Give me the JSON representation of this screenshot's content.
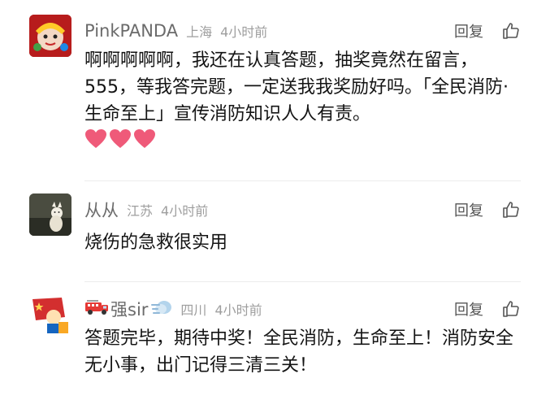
{
  "comments": [
    {
      "username": "PinkPANDA",
      "location": "上海",
      "time": "4小时前",
      "reply": "回复",
      "text": "啊啊啊啊啊，我还在认真答题，抽奖竟然在留言，555，等我答完题，一定送我我奖励好吗。「全民消防·生命至上」宣传消防知识人人有责。",
      "heart_count": 3
    },
    {
      "username": "从从",
      "location": "江苏",
      "time": "4小时前",
      "reply": "回复",
      "text": "烧伤的急救很实用"
    },
    {
      "username": "强sir",
      "location": "四川",
      "time": "4小时前",
      "reply": "回复",
      "text": "答题完毕，期待中奖！全民消防，生命至上！消防安全无小事，出门记得三清三关！"
    }
  ],
  "icons": {
    "like": "thumbs-up-icon",
    "heart": "heart-icon",
    "fire_truck": "fire-truck-emoji",
    "wind": "wind-emoji"
  },
  "colors": {
    "heart": "#ef5a79",
    "meta_gray": "#9e9e9e",
    "username_gray": "#6b6b6b"
  }
}
